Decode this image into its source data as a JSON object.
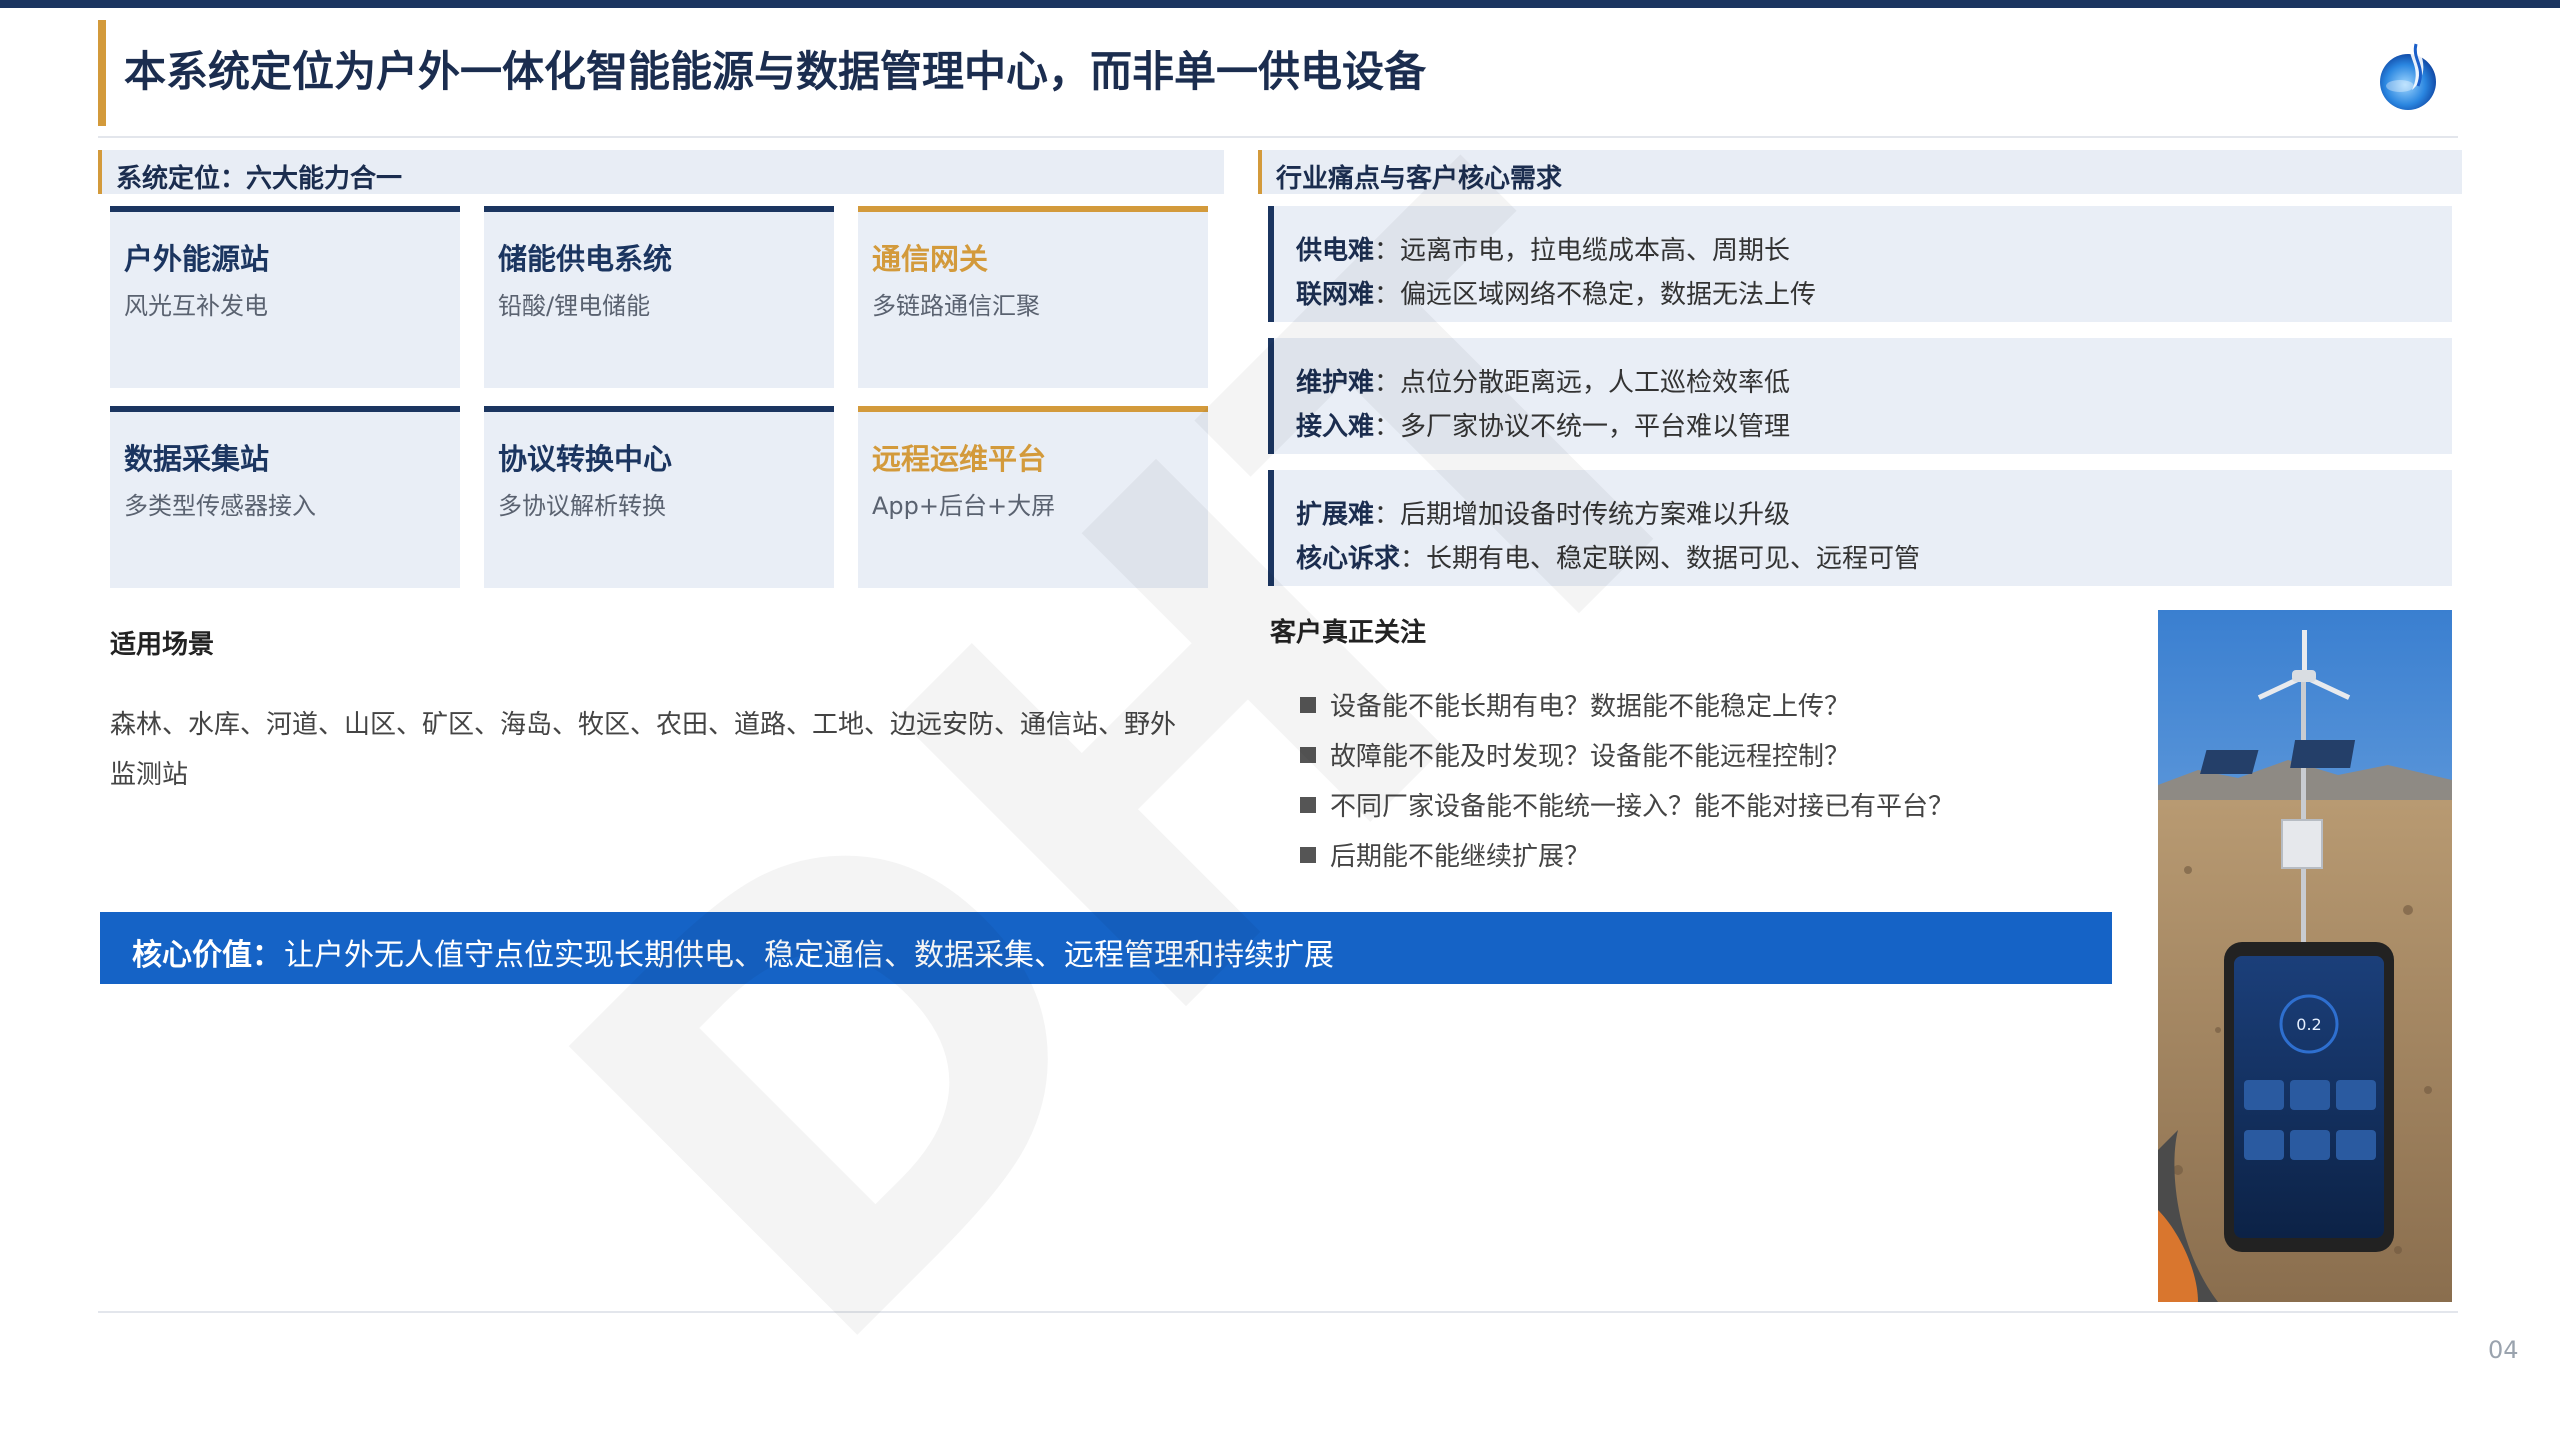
{
  "header": {
    "title": "本系统定位为户外一体化智能能源与数据管理中心，而非单一供电设备"
  },
  "positioning": {
    "heading": "系统定位：六大能力合一",
    "cards": [
      {
        "title": "户外能源站",
        "subtitle": "风光互补发电",
        "accent": "#1b3560"
      },
      {
        "title": "储能供电系统",
        "subtitle": "铅酸/锂电储能",
        "accent": "#1b3560"
      },
      {
        "title": "通信网关",
        "subtitle": "多链路通信汇聚",
        "accent": "#d39a3b"
      },
      {
        "title": "数据采集站",
        "subtitle": "多类型传感器接入",
        "accent": "#1b3560"
      },
      {
        "title": "协议转换中心",
        "subtitle": "多协议解析转换",
        "accent": "#1b3560"
      },
      {
        "title": "远程运维平台",
        "subtitle": "App+后台+大屏",
        "accent": "#d39a3b"
      }
    ]
  },
  "scenarios": {
    "heading": "适用场景",
    "text": "森林、水库、河道、山区、矿区、海岛、牧区、农田、道路、工地、边远安防、通信站、野外监测站"
  },
  "core_value": {
    "label": "核心价值：",
    "text": "让户外无人值守点位实现长期供电、稳定通信、数据采集、远程管理和持续扩展"
  },
  "pain_points": {
    "heading": "行业痛点与客户核心需求",
    "groups": [
      {
        "rows": [
          {
            "label": "供电难",
            "text": "：远离市电，拉电缆成本高、周期长"
          },
          {
            "label": "联网难",
            "text": "：偏远区域网络不稳定，数据无法上传"
          }
        ]
      },
      {
        "rows": [
          {
            "label": "维护难",
            "text": "：点位分散距离远，人工巡检效率低"
          },
          {
            "label": "接入难",
            "text": "：多厂家协议不统一，平台难以管理"
          }
        ]
      },
      {
        "rows": [
          {
            "label": "扩展难",
            "text": "：后期增加设备时传统方案难以升级"
          },
          {
            "label": "核心诉求",
            "text": "：长期有电、稳定联网、数据可见、远程可管"
          }
        ]
      }
    ]
  },
  "customer_focus": {
    "heading": "客户真正关注",
    "items": [
      "设备能不能长期有电？数据能不能稳定上传？",
      "故障能不能及时发现？设备能不能远程控制？",
      "不同厂家设备能不能统一接入？能不能对接已有平台？",
      "后期能不能继续扩展？"
    ]
  },
  "photo": {
    "description_icon": "wind-solar-tower-photo"
  },
  "footer": {
    "page_number": "04"
  },
  "watermark": {
    "text": "DHT"
  },
  "colors": {
    "navy": "#1b3560",
    "gold": "#d39a3b",
    "core_blue": "#1563c6",
    "card_bg": "#e9eef6"
  }
}
